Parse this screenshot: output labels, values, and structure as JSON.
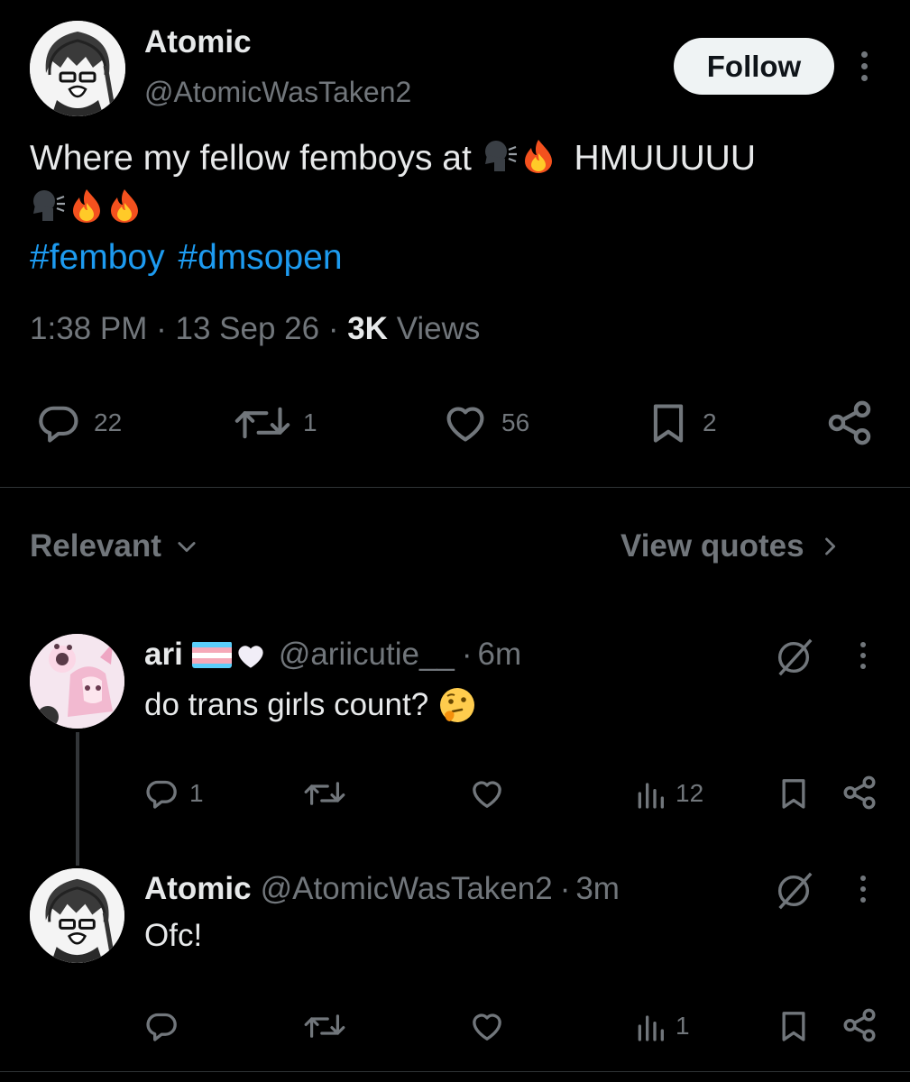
{
  "tweet": {
    "author_name": "Atomic",
    "author_handle": "@AtomicWasTaken2",
    "follow_label": "Follow",
    "text_line1": "Where my fellow femboys at",
    "text_shout": "HMUUUUU",
    "hashtags": [
      "#femboy",
      "#dmsopen"
    ],
    "time": "1:38 PM",
    "date": "13 Sep 26",
    "views_count": "3K",
    "views_label": "Views",
    "replies": "22",
    "reposts": "1",
    "likes": "56",
    "bookmarks": "2"
  },
  "replies_header": {
    "sort_label": "Relevant",
    "quotes_label": "View quotes"
  },
  "replies": [
    {
      "name": "ari",
      "handle": "@ariicutie__",
      "time": "6m",
      "text": "do trans girls count?",
      "reply_count": "1",
      "views": "12"
    },
    {
      "name": "Atomic",
      "handle": "@AtomicWasTaken2",
      "time": "3m",
      "text": "Ofc!",
      "views": "1"
    }
  ],
  "colors": {
    "background": "#000000",
    "text": "#e7e9ea",
    "muted": "#71767b",
    "link": "#1d9bf0",
    "divider": "#2f3336"
  }
}
